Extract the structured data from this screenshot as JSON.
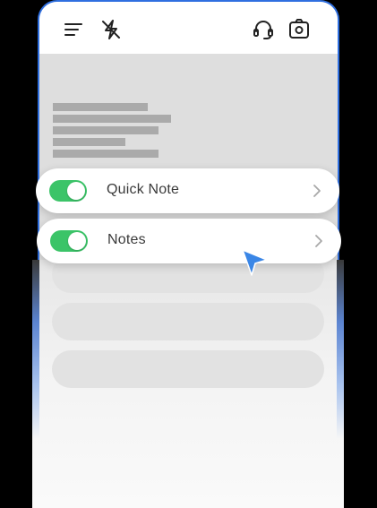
{
  "topbar": {
    "icons": [
      "menu-icon",
      "flash-off-icon",
      "headset-icon",
      "camera-switch-icon"
    ]
  },
  "items": [
    {
      "label": "Quick Note",
      "enabled": true
    },
    {
      "label": "Notes",
      "enabled": true
    }
  ],
  "colors": {
    "accent_border": "#2f6fe0",
    "toggle_on": "#3bc468",
    "cursor": "#3a86e6"
  }
}
